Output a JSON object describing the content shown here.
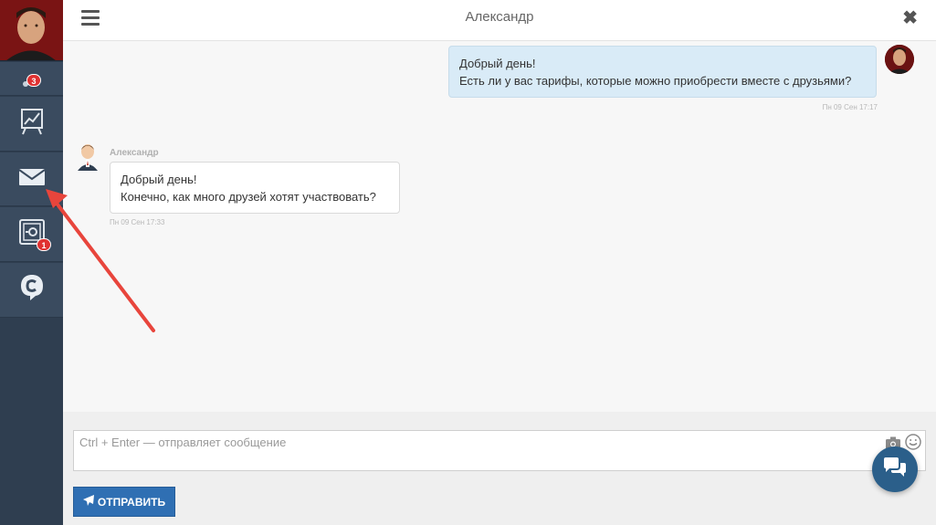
{
  "header": {
    "title": "Александр"
  },
  "sidebar": {
    "badges": {
      "notifications": "3",
      "safe": "1"
    }
  },
  "messages": [
    {
      "direction": "out",
      "lines": [
        "Добрый день!",
        "Есть ли у вас тарифы, которые можно приобрести вместе с друзьями?"
      ],
      "timestamp": "Пн 09 Сен 17:17"
    },
    {
      "direction": "in",
      "sender": "Александр",
      "lines": [
        "Добрый день!",
        "Конечно, как много друзей хотят участвовать?"
      ],
      "timestamp": "Пн 09 Сен 17:33"
    }
  ],
  "composer": {
    "placeholder": "Ctrl + Enter — отправляет сообщение",
    "value": "",
    "send_label": "ОТПРАВИТЬ"
  },
  "colors": {
    "sidebar": "#2f3e50",
    "sidebar_item": "#3a4b5f",
    "badge": "#e03131",
    "outgoing_bubble": "#d9ebf7",
    "send_button": "#2f6fb3",
    "chat_fab": "#2b5f8a",
    "annotation_arrow": "#e8453c"
  },
  "icons": {
    "menu": "hamburger-icon",
    "close": "close-icon",
    "notifications": "bell-icon",
    "chart": "chart-board-icon",
    "mail": "envelope-icon",
    "safe": "safe-icon",
    "brand": "brand-logo-icon",
    "camera": "camera-icon",
    "emoji": "smile-icon",
    "send": "paper-plane-icon",
    "chat": "chat-bubbles-icon"
  }
}
